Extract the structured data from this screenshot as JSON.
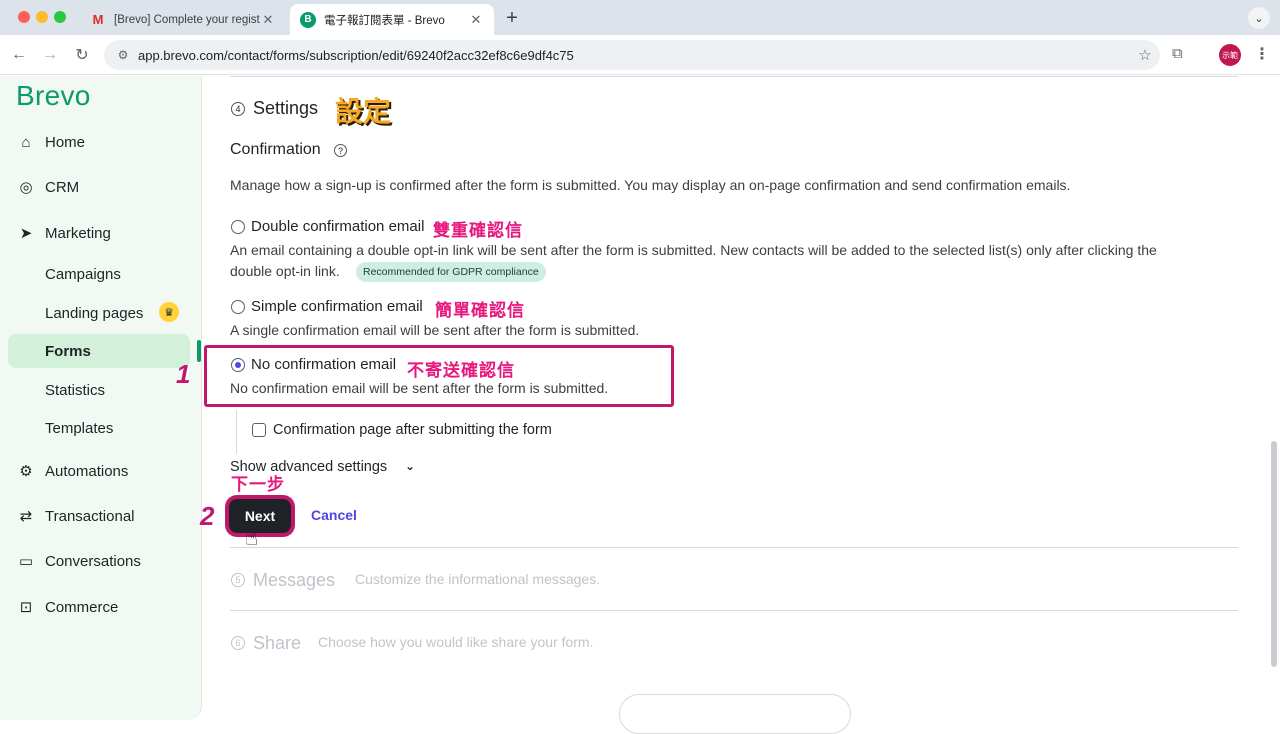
{
  "browser": {
    "tabs": [
      {
        "title": "[Brevo] Complete your registr",
        "icon": "gmail-icon"
      },
      {
        "title": "電子報訂閱表單 - Brevo",
        "icon": "brevo-favicon"
      }
    ],
    "url": "app.brevo.com/contact/forms/subscription/edit/69240f2acc32ef8c6e9df4c75",
    "profile_initials": "示範"
  },
  "sidebar": {
    "logo": "Brevo",
    "items": [
      {
        "label": "Home",
        "icon": "home-icon"
      },
      {
        "label": "CRM",
        "icon": "crm-icon"
      },
      {
        "label": "Marketing",
        "icon": "send-icon"
      },
      {
        "label": "Automations",
        "icon": "automation-icon"
      },
      {
        "label": "Transactional",
        "icon": "transactional-icon"
      },
      {
        "label": "Conversations",
        "icon": "chat-icon"
      },
      {
        "label": "Commerce",
        "icon": "bag-icon"
      }
    ],
    "marketing_sub": [
      "Campaigns",
      "Landing pages",
      "Forms",
      "Statistics",
      "Templates"
    ],
    "active": "Forms",
    "accent": "#0b996e"
  },
  "settings": {
    "step_number": "4",
    "title": "Settings",
    "title_annotation": "設定",
    "confirmation_heading": "Confirmation",
    "description": "Manage how a sign-up is confirmed after the form is submitted. You may display an on-page confirmation and send confirmation emails.",
    "options": [
      {
        "label": "Double confirmation email",
        "annotation": "雙重確認信",
        "desc_line1": "An email containing a double opt-in link will be sent after the form is submitted. New contacts will be added to the selected list(s) only after clicking the",
        "desc_line2": "double opt-in link.",
        "badge": "Recommended for GDPR compliance",
        "checked": false
      },
      {
        "label": "Simple confirmation email",
        "annotation": "簡單確認信",
        "desc_line1": "A single confirmation email will be sent after the form is submitted.",
        "checked": false
      },
      {
        "label": "No confirmation email",
        "annotation": "不寄送確認信",
        "desc_line1": "No confirmation email will be sent after the form is submitted.",
        "checked": true
      }
    ],
    "confirmation_page_label": "Confirmation page after submitting the form",
    "confirmation_page_checked": false,
    "advanced_label": "Show advanced settings",
    "next_label": "Next",
    "next_annotation": "下一步",
    "cancel_label": "Cancel",
    "step_annotations": [
      "1",
      "2"
    ]
  },
  "steps": [
    {
      "number": "5",
      "title": "Messages",
      "desc": "Customize the informational messages."
    },
    {
      "number": "6",
      "title": "Share",
      "desc": "Choose how you would like share your form."
    }
  ]
}
